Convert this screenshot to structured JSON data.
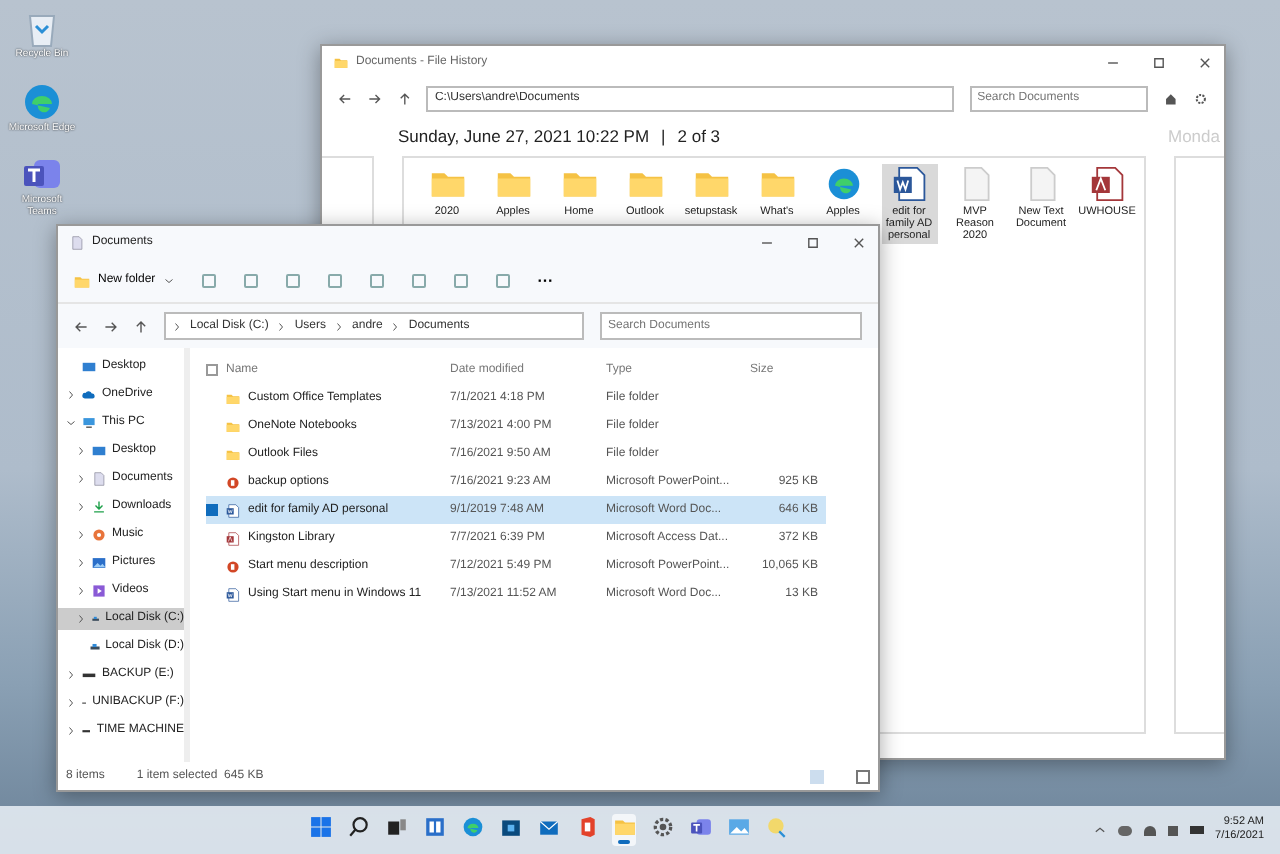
{
  "desktop_icons": [
    {
      "label": "Recycle Bin",
      "kind": "bin"
    },
    {
      "label": "Microsoft Edge",
      "kind": "edge"
    },
    {
      "label": "Microsoft Teams",
      "kind": "teams"
    }
  ],
  "file_history": {
    "title": "Documents - File History",
    "address": "C:\\Users\\andre\\Documents",
    "search": {
      "placeholder": "Search Documents"
    },
    "date": "Sunday, June 27, 2021 10:22 PM",
    "separator": "|",
    "position": "2 of 3",
    "next_date": "Monda",
    "items": [
      {
        "label": "2020",
        "kind": "folder",
        "selected": false
      },
      {
        "label": "Apples",
        "kind": "folder",
        "selected": false
      },
      {
        "label": "Home",
        "kind": "folder",
        "selected": false
      },
      {
        "label": "Outlook",
        "kind": "folder",
        "selected": false
      },
      {
        "label": "setupstask",
        "kind": "folder",
        "selected": false
      },
      {
        "label": "What's",
        "kind": "folder",
        "selected": false
      },
      {
        "label": "Apples",
        "kind": "edge",
        "selected": false
      },
      {
        "label": "edit for family AD personal",
        "kind": "word",
        "selected": true
      },
      {
        "label": "MVP Reason 2020",
        "kind": "doc",
        "selected": false
      },
      {
        "label": "New Text Document",
        "kind": "doc",
        "selected": false
      },
      {
        "label": "UWHOUSE",
        "kind": "access",
        "selected": false
      }
    ]
  },
  "explorer": {
    "title": "Documents",
    "new_button": "New folder",
    "more": "···",
    "breadcrumb": [
      "Local Disk (C:)",
      "Users",
      "andre",
      "Documents"
    ],
    "search": {
      "placeholder": "Search Documents"
    },
    "sidebar": [
      {
        "label": "Desktop",
        "kind": "desktop"
      },
      {
        "label": "OneDrive",
        "kind": "cloud",
        "expanded": false
      },
      {
        "label": "This PC",
        "kind": "pc",
        "expanded": true,
        "children": [
          {
            "label": "Desktop",
            "kind": "desktop",
            "expanded": false
          },
          {
            "label": "Documents",
            "kind": "documents",
            "expanded": false
          },
          {
            "label": "Downloads",
            "kind": "downloads",
            "expanded": false
          },
          {
            "label": "Music",
            "kind": "music",
            "expanded": false
          },
          {
            "label": "Pictures",
            "kind": "pictures",
            "expanded": false
          },
          {
            "label": "Videos",
            "kind": "videos",
            "expanded": false
          },
          {
            "label": "Local Disk (C:)",
            "kind": "disk",
            "expanded": false,
            "selected": true
          },
          {
            "label": "Local Disk (D:)",
            "kind": "disk",
            "selected": false
          }
        ]
      },
      {
        "label": "BACKUP (E:)",
        "kind": "drive",
        "expanded": false
      },
      {
        "label": "UNIBACKUP (F:)",
        "kind": "drive",
        "expanded": false
      },
      {
        "label": "TIME MACHINE",
        "kind": "drive",
        "expanded": false
      }
    ],
    "columns": [
      "Name",
      "Date modified",
      "Type",
      "Size"
    ],
    "select_all_checked": false,
    "rows": [
      {
        "name": "Custom Office Templates",
        "date": "7/1/2021 4:18 PM",
        "type": "File folder",
        "kind": "folder",
        "selected": false
      },
      {
        "name": "OneNote Notebooks",
        "date": "7/13/2021 4:00 PM",
        "type": "File folder",
        "kind": "folder",
        "selected": false
      },
      {
        "name": "Outlook Files",
        "date": "7/16/2021 9:50 AM",
        "type": "File folder",
        "kind": "folder",
        "selected": false
      },
      {
        "name": "backup options",
        "date": "7/16/2021 9:23 AM",
        "type": "Microsoft PowerPoint...",
        "size": "925 KB",
        "kind": "ppt",
        "selected": false
      },
      {
        "name": "edit for family AD personal",
        "date": "9/1/2019 7:48 AM",
        "type": "Microsoft Word Doc...",
        "size": "646 KB",
        "kind": "word",
        "selected": true
      },
      {
        "name": "Kingston Library",
        "date": "7/7/2021 6:39 PM",
        "type": "Microsoft Access Dat...",
        "size": "372 KB",
        "kind": "access",
        "selected": false
      },
      {
        "name": "Start menu description",
        "date": "7/12/2021 5:49 PM",
        "type": "Microsoft PowerPoint...",
        "size": "10,065 KB",
        "kind": "ppt",
        "selected": false
      },
      {
        "name": "Using Start menu in Windows 11",
        "date": "7/13/2021 11:52 AM",
        "type": "Microsoft Word Doc...",
        "size": "13 KB",
        "kind": "word",
        "selected": false
      }
    ],
    "status": {
      "count": "8 items",
      "selection": "1 item selected  645 KB"
    }
  },
  "taskbar": {
    "apps": [
      {
        "kind": "start",
        "active": false
      },
      {
        "kind": "search",
        "active": false
      },
      {
        "kind": "taskview",
        "active": false
      },
      {
        "kind": "widgets",
        "active": false
      },
      {
        "kind": "edge",
        "active": false
      },
      {
        "kind": "store",
        "active": false
      },
      {
        "kind": "mail",
        "active": false
      },
      {
        "kind": "office",
        "active": false
      },
      {
        "kind": "folder",
        "active": true
      },
      {
        "kind": "settings",
        "active": false
      },
      {
        "kind": "teams",
        "active": false
      },
      {
        "kind": "photos",
        "active": false
      },
      {
        "kind": "paint",
        "active": false
      }
    ],
    "time": "9:52 AM",
    "date": "7/16/2021"
  }
}
